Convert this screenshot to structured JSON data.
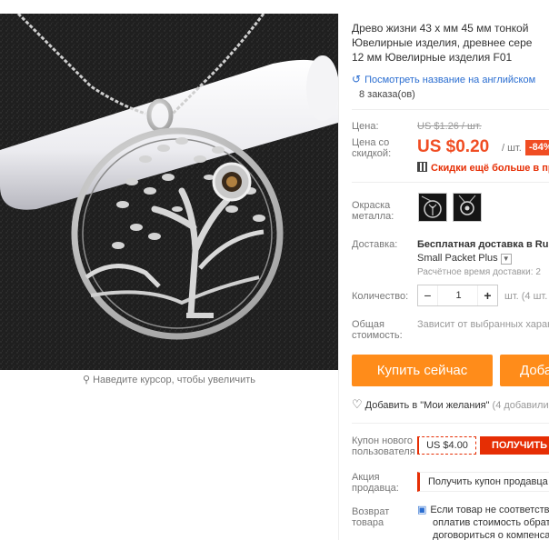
{
  "gallery": {
    "zoom_hint": "Наведите курсор, чтобы увеличить"
  },
  "product": {
    "title_lines": [
      "Древо жизни 43 х мм 45 мм тонкой",
      "Ювелирные изделия, древнее сере",
      "12 мм Ювелирные изделия F01"
    ],
    "translate_link": "Посмотреть название на английском",
    "orders": "8 заказа(ов)"
  },
  "price": {
    "label": "Цена:",
    "old": "US $1.26 / шт.",
    "discount_label_1": "Цена со",
    "discount_label_2": "скидкой:",
    "new": "US $0.20",
    "per_unit": "/ шт.",
    "discount_badge": "-84%",
    "bulk": "Скидки ещё больше в при"
  },
  "color": {
    "label_1": "Окраска",
    "label_2": "металла:"
  },
  "shipping": {
    "label": "Доставка:",
    "main": "Бесплатная доставка в Russ",
    "service": "Small Packet Plus",
    "time": "Расчётное время доставки: 2"
  },
  "quantity": {
    "label": "Количество:",
    "minus": "−",
    "value": "1",
    "plus": "+",
    "unit": "шт. (4 шт."
  },
  "total": {
    "label_1": "Общая",
    "label_2": "стоимость:",
    "value": "Зависит от выбранных харак"
  },
  "actions": {
    "buy_now": "Купить сейчас",
    "add_to_cart": "Доба",
    "wishlist": "Добавить в \"Мои желания\"",
    "wishlist_count": "(4 добавили"
  },
  "coupon": {
    "label_1": "Купон нового",
    "label_2": "пользователя",
    "value": "US $4.00",
    "button": "ПОЛУЧИТЬ"
  },
  "promo": {
    "label_1": "Акция",
    "label_2": "продавца:",
    "text": "Получить купон продавца"
  },
  "returns": {
    "label_1": "Возврат",
    "label_2": "товара",
    "line_1": "Если товар не соответству",
    "line_2": "оплатив стоимость обрат",
    "line_3": "договориться о компенса"
  },
  "colors": {
    "accent": "#ff8c1a",
    "price_red": "#f04d23",
    "link_blue": "#2b6ed1"
  }
}
